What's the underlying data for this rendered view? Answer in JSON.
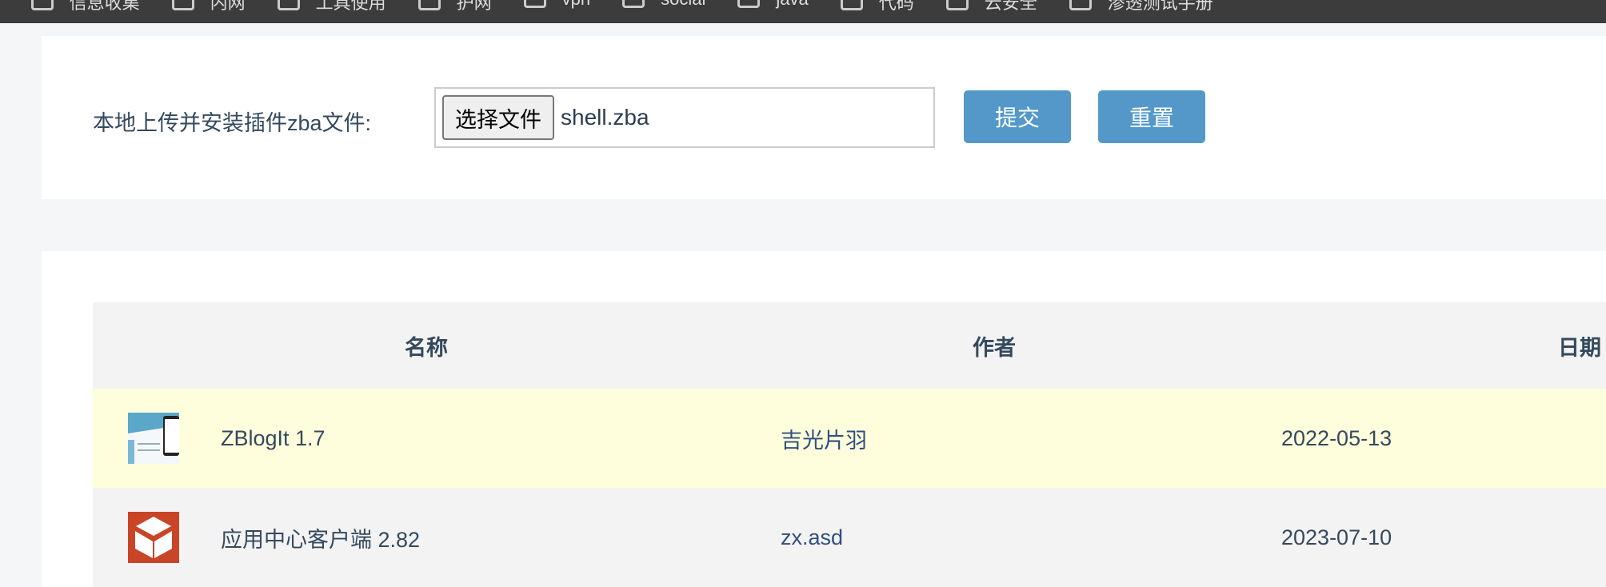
{
  "bookmarks": [
    "信息收集",
    "内网",
    "工具使用",
    "护网",
    "vpn",
    "social",
    "java",
    "代码",
    "云安全",
    "渗透测试手册"
  ],
  "upload": {
    "label": "本地上传并安装插件zba文件:",
    "choose_label": "选择文件",
    "file_name": "shell.zba",
    "submit_label": "提交",
    "reset_label": "重置"
  },
  "table": {
    "headers": [
      "名称",
      "作者",
      "日期"
    ],
    "rows": [
      {
        "name": "ZBlogIt 1.7",
        "author": "吉光片羽",
        "date": "2022-05-13",
        "icon": "screenshot-thumbnail"
      },
      {
        "name": "应用中心客户端 2.82",
        "author": "zx.asd",
        "date": "2023-07-10",
        "icon": "box-icon"
      }
    ]
  },
  "colors": {
    "button": "#5398c9",
    "highlight_row": "#fffedc",
    "app_icon": "#c94528"
  }
}
